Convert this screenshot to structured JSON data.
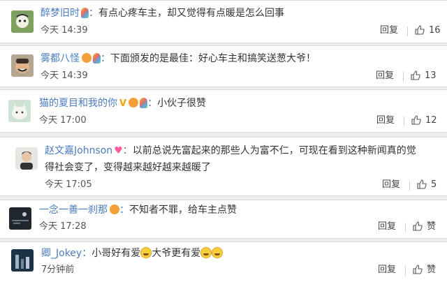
{
  "comments": [
    {
      "username": "醉梦旧时",
      "colon": "：",
      "message": "有点心疼车主，却又觉得有点暖是怎么回事",
      "time": "今天 14:39",
      "reply_label": "回复",
      "likes": "16"
    },
    {
      "username": "雾都八怪",
      "colon": "：",
      "message": "下面颁发的是最佳：好心车主和搞笑送葱大爷！",
      "time": "今天 14:39",
      "reply_label": "回复",
      "likes": "13"
    },
    {
      "username": "猫的夏目和我的你",
      "colon": "：",
      "message": "小伙子很赞",
      "time": "今天 17:00",
      "reply_label": "回复",
      "likes": "12"
    },
    {
      "username": "赵文嘉Johnson",
      "colon": "：",
      "message_line1": "以前总说先富起来的那些人为富不仁，可现在看到这种新闻真的觉",
      "message_line2": "得社会变了，变得越来越好越来越暖了",
      "time": "今天 17:05",
      "reply_label": "回复",
      "likes": "5"
    },
    {
      "username": "一念一善一刹那",
      "colon": "：",
      "message": "不知者不罪，给车主点赞",
      "time": "今天 17:28",
      "reply_label": "回复",
      "likes": "赞"
    },
    {
      "username": "卿_Jokey",
      "colon": "：",
      "message_part1": "小哥好有爱",
      "message_part2": "大爷更有爱",
      "time": "7分钟前",
      "reply_label": "回复",
      "likes": "赞"
    }
  ],
  "icons": {
    "like": "thumbs-up-icon",
    "badge": "colored-bulb-badge"
  },
  "colors": {
    "username": "#4b7bbf",
    "background": "#ececec",
    "card": "#ffffff"
  }
}
